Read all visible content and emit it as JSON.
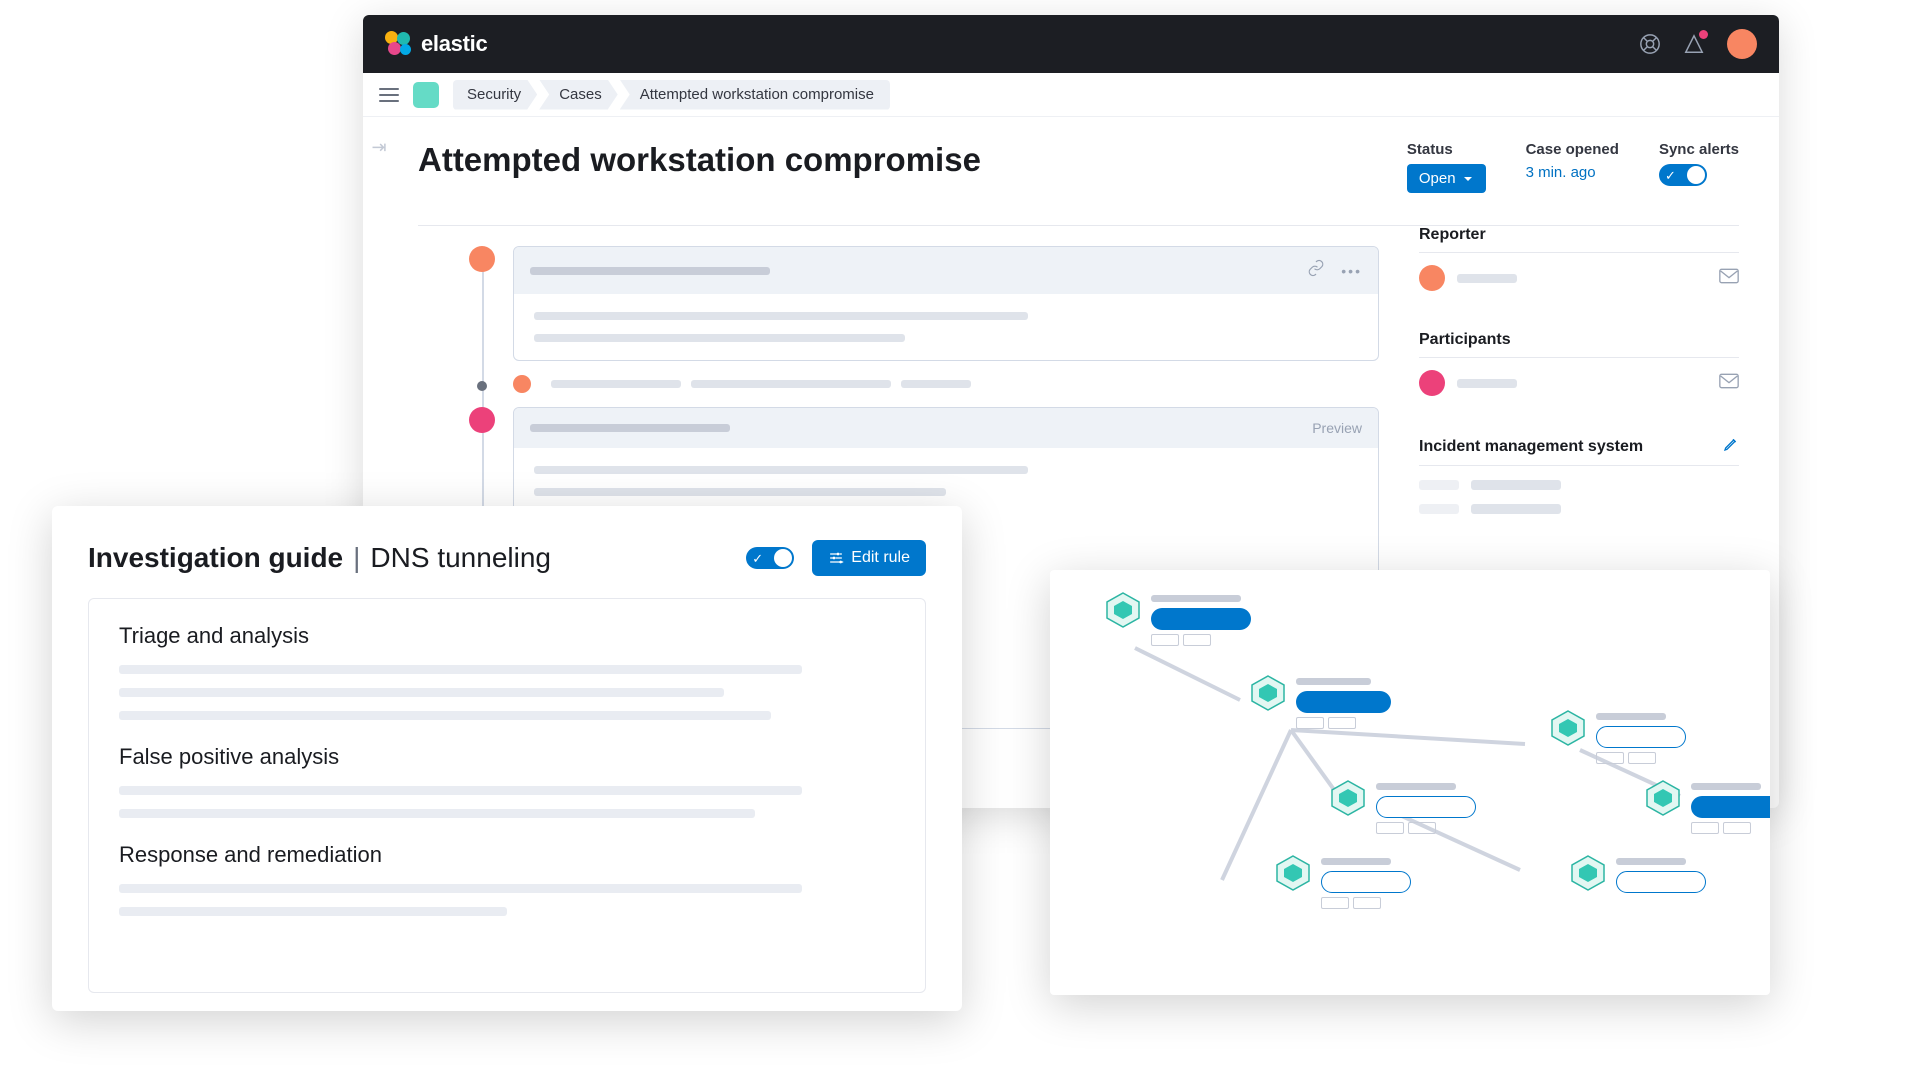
{
  "brand": {
    "name": "elastic"
  },
  "breadcrumbs": [
    "Security",
    "Cases",
    "Attempted workstation compromise"
  ],
  "page": {
    "title": "Attempted workstation compromise",
    "status_label": "Status",
    "status_value": "Open",
    "opened_label": "Case opened",
    "opened_value": "3 min. ago",
    "sync_label": "Sync alerts"
  },
  "timeline": {
    "preview_label": "Preview"
  },
  "sidebar": {
    "reporter_title": "Reporter",
    "participants_title": "Participants",
    "ims_title": "Incident management system"
  },
  "guide": {
    "title_bold": "Investigation guide",
    "title_sub": "DNS tunneling",
    "edit_label": "Edit rule",
    "sections": {
      "s1": "Triage and analysis",
      "s2": "False positive analysis",
      "s3": "Response and remediation"
    }
  },
  "colors": {
    "accent": "#0077cc",
    "orange": "#f88662",
    "pink": "#ec417a",
    "teal": "#65dbc6"
  }
}
